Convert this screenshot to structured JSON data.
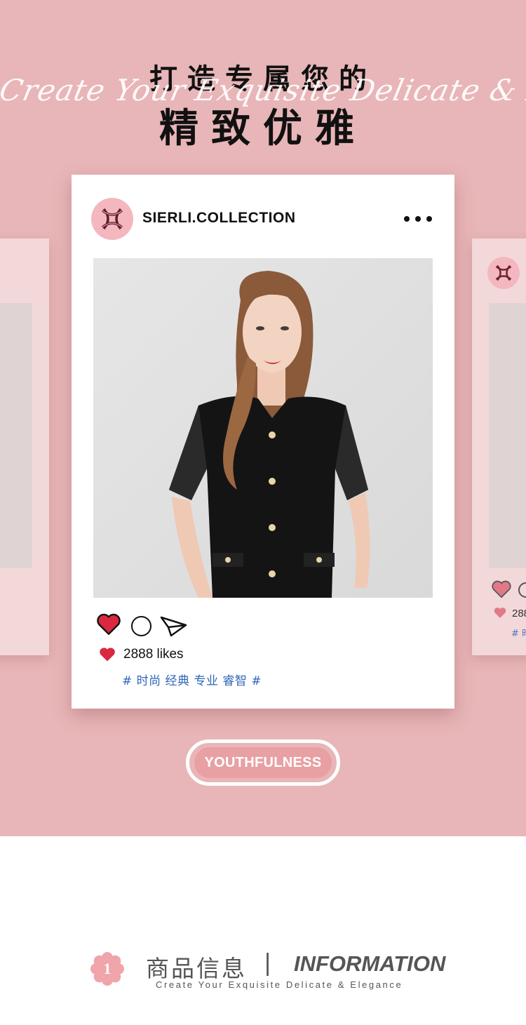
{
  "header": {
    "title_line1": "打造专属您的",
    "script_text": "Create Your Exquisite Delicate & Elegance",
    "title_line2": "精致优雅"
  },
  "post": {
    "account_name": "SIERLI.COLLECTION",
    "avatar_logo": "sierli-logo-icon",
    "likes": "2888 likes",
    "hashtags": "# 时尚 经典 专业 睿智 #",
    "actions": [
      "heart-icon",
      "comment-icon",
      "send-icon"
    ]
  },
  "side_card": {
    "likes": "288",
    "hashtag": "# 时"
  },
  "tag_button": {
    "label": "YOUTHFULNESS"
  },
  "section": {
    "number": "1",
    "title_cn": "商品信息",
    "separator": "|",
    "title_en": "INFORMATION",
    "subtitle": "Create Your Exquisite Delicate & Elegance"
  },
  "colors": {
    "background_pink": "#e8b6b8",
    "side_card": "#f3d8da",
    "heart_red": "#d9283f",
    "hashtag_blue": "#2f66b8",
    "pill_fill": "#e8a0a3"
  }
}
